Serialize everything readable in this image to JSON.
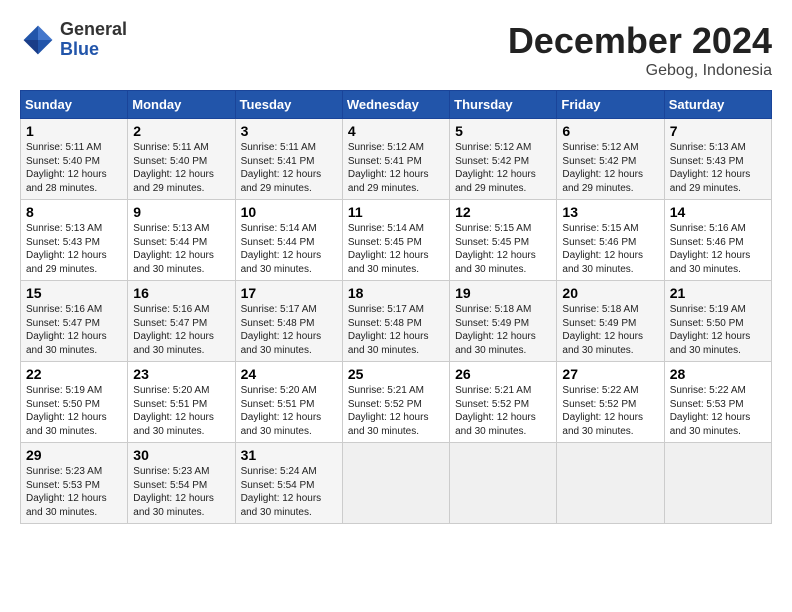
{
  "header": {
    "logo_general": "General",
    "logo_blue": "Blue",
    "month_title": "December 2024",
    "location": "Gebog, Indonesia"
  },
  "weekdays": [
    "Sunday",
    "Monday",
    "Tuesday",
    "Wednesday",
    "Thursday",
    "Friday",
    "Saturday"
  ],
  "weeks": [
    [
      {
        "day": "1",
        "sunrise": "Sunrise: 5:11 AM",
        "sunset": "Sunset: 5:40 PM",
        "daylight": "Daylight: 12 hours and 28 minutes."
      },
      {
        "day": "2",
        "sunrise": "Sunrise: 5:11 AM",
        "sunset": "Sunset: 5:40 PM",
        "daylight": "Daylight: 12 hours and 29 minutes."
      },
      {
        "day": "3",
        "sunrise": "Sunrise: 5:11 AM",
        "sunset": "Sunset: 5:41 PM",
        "daylight": "Daylight: 12 hours and 29 minutes."
      },
      {
        "day": "4",
        "sunrise": "Sunrise: 5:12 AM",
        "sunset": "Sunset: 5:41 PM",
        "daylight": "Daylight: 12 hours and 29 minutes."
      },
      {
        "day": "5",
        "sunrise": "Sunrise: 5:12 AM",
        "sunset": "Sunset: 5:42 PM",
        "daylight": "Daylight: 12 hours and 29 minutes."
      },
      {
        "day": "6",
        "sunrise": "Sunrise: 5:12 AM",
        "sunset": "Sunset: 5:42 PM",
        "daylight": "Daylight: 12 hours and 29 minutes."
      },
      {
        "day": "7",
        "sunrise": "Sunrise: 5:13 AM",
        "sunset": "Sunset: 5:43 PM",
        "daylight": "Daylight: 12 hours and 29 minutes."
      }
    ],
    [
      {
        "day": "8",
        "sunrise": "Sunrise: 5:13 AM",
        "sunset": "Sunset: 5:43 PM",
        "daylight": "Daylight: 12 hours and 29 minutes."
      },
      {
        "day": "9",
        "sunrise": "Sunrise: 5:13 AM",
        "sunset": "Sunset: 5:44 PM",
        "daylight": "Daylight: 12 hours and 30 minutes."
      },
      {
        "day": "10",
        "sunrise": "Sunrise: 5:14 AM",
        "sunset": "Sunset: 5:44 PM",
        "daylight": "Daylight: 12 hours and 30 minutes."
      },
      {
        "day": "11",
        "sunrise": "Sunrise: 5:14 AM",
        "sunset": "Sunset: 5:45 PM",
        "daylight": "Daylight: 12 hours and 30 minutes."
      },
      {
        "day": "12",
        "sunrise": "Sunrise: 5:15 AM",
        "sunset": "Sunset: 5:45 PM",
        "daylight": "Daylight: 12 hours and 30 minutes."
      },
      {
        "day": "13",
        "sunrise": "Sunrise: 5:15 AM",
        "sunset": "Sunset: 5:46 PM",
        "daylight": "Daylight: 12 hours and 30 minutes."
      },
      {
        "day": "14",
        "sunrise": "Sunrise: 5:16 AM",
        "sunset": "Sunset: 5:46 PM",
        "daylight": "Daylight: 12 hours and 30 minutes."
      }
    ],
    [
      {
        "day": "15",
        "sunrise": "Sunrise: 5:16 AM",
        "sunset": "Sunset: 5:47 PM",
        "daylight": "Daylight: 12 hours and 30 minutes."
      },
      {
        "day": "16",
        "sunrise": "Sunrise: 5:16 AM",
        "sunset": "Sunset: 5:47 PM",
        "daylight": "Daylight: 12 hours and 30 minutes."
      },
      {
        "day": "17",
        "sunrise": "Sunrise: 5:17 AM",
        "sunset": "Sunset: 5:48 PM",
        "daylight": "Daylight: 12 hours and 30 minutes."
      },
      {
        "day": "18",
        "sunrise": "Sunrise: 5:17 AM",
        "sunset": "Sunset: 5:48 PM",
        "daylight": "Daylight: 12 hours and 30 minutes."
      },
      {
        "day": "19",
        "sunrise": "Sunrise: 5:18 AM",
        "sunset": "Sunset: 5:49 PM",
        "daylight": "Daylight: 12 hours and 30 minutes."
      },
      {
        "day": "20",
        "sunrise": "Sunrise: 5:18 AM",
        "sunset": "Sunset: 5:49 PM",
        "daylight": "Daylight: 12 hours and 30 minutes."
      },
      {
        "day": "21",
        "sunrise": "Sunrise: 5:19 AM",
        "sunset": "Sunset: 5:50 PM",
        "daylight": "Daylight: 12 hours and 30 minutes."
      }
    ],
    [
      {
        "day": "22",
        "sunrise": "Sunrise: 5:19 AM",
        "sunset": "Sunset: 5:50 PM",
        "daylight": "Daylight: 12 hours and 30 minutes."
      },
      {
        "day": "23",
        "sunrise": "Sunrise: 5:20 AM",
        "sunset": "Sunset: 5:51 PM",
        "daylight": "Daylight: 12 hours and 30 minutes."
      },
      {
        "day": "24",
        "sunrise": "Sunrise: 5:20 AM",
        "sunset": "Sunset: 5:51 PM",
        "daylight": "Daylight: 12 hours and 30 minutes."
      },
      {
        "day": "25",
        "sunrise": "Sunrise: 5:21 AM",
        "sunset": "Sunset: 5:52 PM",
        "daylight": "Daylight: 12 hours and 30 minutes."
      },
      {
        "day": "26",
        "sunrise": "Sunrise: 5:21 AM",
        "sunset": "Sunset: 5:52 PM",
        "daylight": "Daylight: 12 hours and 30 minutes."
      },
      {
        "day": "27",
        "sunrise": "Sunrise: 5:22 AM",
        "sunset": "Sunset: 5:52 PM",
        "daylight": "Daylight: 12 hours and 30 minutes."
      },
      {
        "day": "28",
        "sunrise": "Sunrise: 5:22 AM",
        "sunset": "Sunset: 5:53 PM",
        "daylight": "Daylight: 12 hours and 30 minutes."
      }
    ],
    [
      {
        "day": "29",
        "sunrise": "Sunrise: 5:23 AM",
        "sunset": "Sunset: 5:53 PM",
        "daylight": "Daylight: 12 hours and 30 minutes."
      },
      {
        "day": "30",
        "sunrise": "Sunrise: 5:23 AM",
        "sunset": "Sunset: 5:54 PM",
        "daylight": "Daylight: 12 hours and 30 minutes."
      },
      {
        "day": "31",
        "sunrise": "Sunrise: 5:24 AM",
        "sunset": "Sunset: 5:54 PM",
        "daylight": "Daylight: 12 hours and 30 minutes."
      },
      null,
      null,
      null,
      null
    ]
  ]
}
